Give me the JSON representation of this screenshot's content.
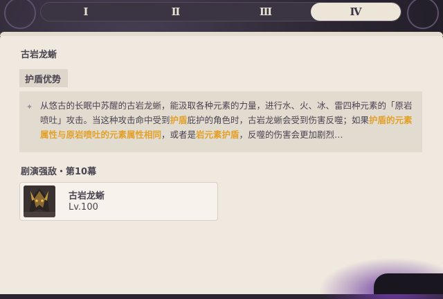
{
  "tabs": [
    {
      "label": "Ⅰ",
      "active": false
    },
    {
      "label": "Ⅱ",
      "active": false
    },
    {
      "label": "Ⅲ",
      "active": false
    },
    {
      "label": "Ⅳ",
      "active": true
    }
  ],
  "boss_title": "古岩龙蜥",
  "tag": "护盾优势",
  "description": {
    "part1": "从悠古的长眠中苏醒的古岩龙蜥，能汲取各种元素的力量，进行水、火、冰、雷四种元素的「原岩喷吐」攻击。当这种攻击命中受到",
    "hl1": "护盾",
    "part2": "庇护的角色时，古岩龙蜥会受到伤害反噬；如果",
    "hl2": "护盾的元素属性与原岩喷吐的元素属性相同",
    "part3": "，或者是",
    "hl3": "岩元素护盾",
    "part4": "，反噬的伤害会更加剧烈…"
  },
  "stage_title": "剧演强敌・第10幕",
  "enemy": {
    "name": "古岩龙蜥",
    "level": "Lv.100"
  },
  "colors": {
    "highlight": "#e2a12a",
    "panel": "#efe9df",
    "text": "#4a4450"
  }
}
